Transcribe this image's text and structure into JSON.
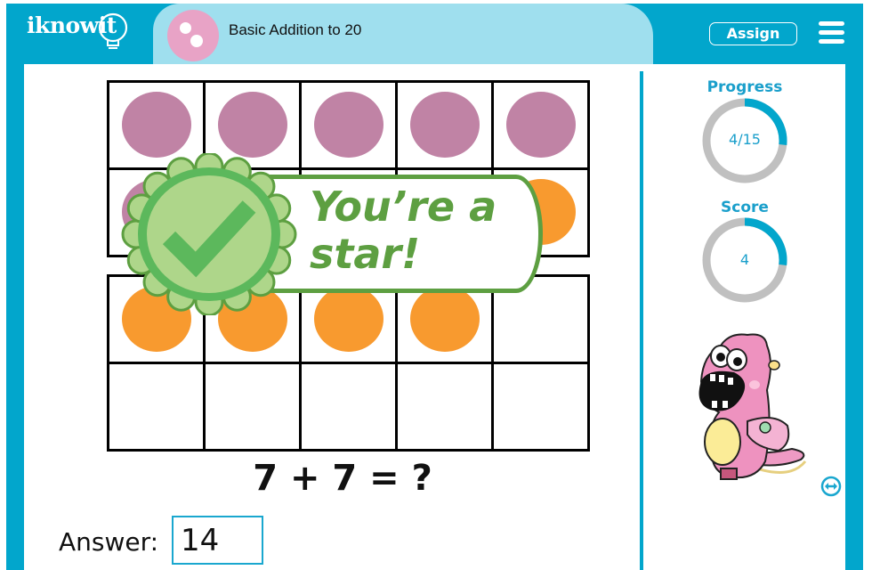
{
  "header": {
    "logo_text": "iknowit",
    "topic_title": "Basic Addition to 20",
    "assign_label": "Assign",
    "menu_icon": "hamburger-menu-icon"
  },
  "colors": {
    "brand_blue": "#02a6cc",
    "header_light": "#9fdfee",
    "purple_counter": "#c083a5",
    "orange_counter": "#f89a2f",
    "success_green": "#5d9f41",
    "ring_track": "#c0c0c0"
  },
  "problem": {
    "ten_frames": [
      {
        "cells": [
          "purple",
          "purple",
          "purple",
          "purple",
          "purple",
          "purple",
          "purple",
          "orange",
          "orange",
          "orange"
        ]
      },
      {
        "cells": [
          "orange",
          "orange",
          "orange",
          "orange",
          "empty",
          "empty",
          "empty",
          "empty",
          "empty",
          "empty"
        ]
      }
    ],
    "equation": "7 + 7 = ?",
    "answer_label": "Answer:",
    "answer_value": "14"
  },
  "feedback": {
    "message_line1": "You’re a",
    "message_line2": "star!",
    "icon": "checkmark-seal-icon"
  },
  "sidebar": {
    "progress": {
      "title": "Progress",
      "value_text": "4/15",
      "current": 4,
      "total": 15
    },
    "score": {
      "title": "Score",
      "value_text": "4",
      "fraction": 0.27
    },
    "mascot": "pink-monster-mascot",
    "swap_icon": "swap-horizontal-icon"
  }
}
